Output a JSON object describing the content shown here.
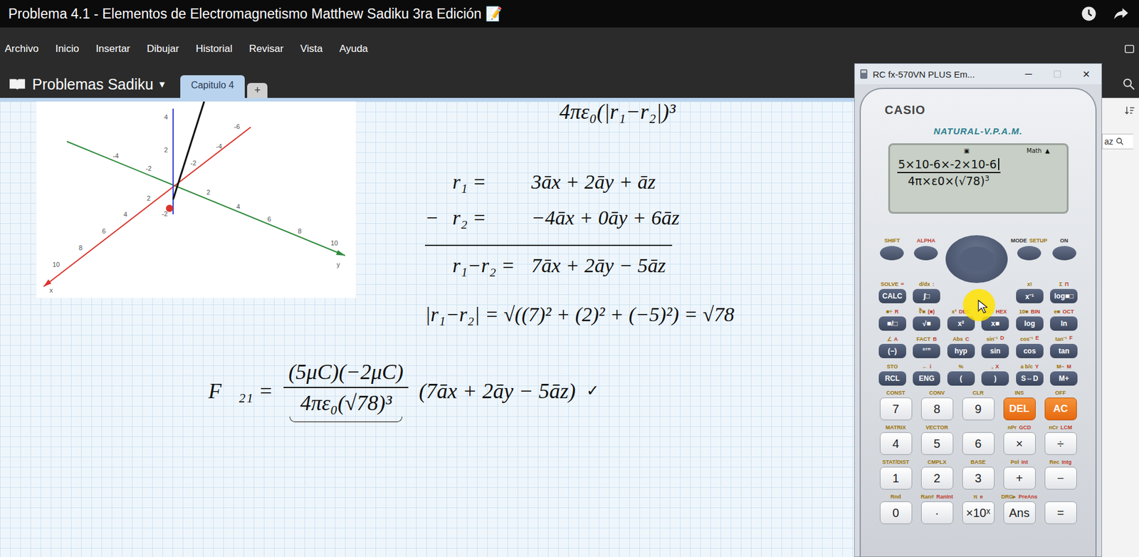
{
  "video": {
    "title": "Problema 4.1 - Elementos de Electromagnetismo Matthew Sadiku 3ra Edición 📝"
  },
  "menu": [
    "Archivo",
    "Inicio",
    "Insertar",
    "Dibujar",
    "Historial",
    "Revisar",
    "Vista",
    "Ayuda"
  ],
  "notebook": {
    "name": "Problemas Sadiku",
    "caret": "▾"
  },
  "tabs": [
    {
      "label": "Capitulo 4",
      "selected": true
    },
    {
      "label": "+",
      "selected": false
    }
  ],
  "graph": {
    "y_labels": [
      "-4",
      "-2",
      "2",
      "4",
      "6",
      "8",
      "10",
      "y"
    ],
    "x_labels": [
      "-6",
      "-4",
      "-2",
      "2",
      "4",
      "6",
      "8",
      "10",
      "x"
    ],
    "z_labels": [
      "4",
      "2",
      "-2"
    ]
  },
  "work": {
    "header": "4πε₀(|r₁−r₂|)³",
    "lines": [
      {
        "sign": "",
        "lhs": "r₁ =",
        "rhs": "3āx + 2āy + āz"
      },
      {
        "sign": "−",
        "lhs": "r₂ =",
        "rhs": "−4āx + 0āy + 6āz"
      },
      {
        "sign": "",
        "lhs": "r₁−r₂ =",
        "rhs": "7āx + 2āy − 5āz"
      }
    ],
    "magnitude": "|r₁−r₂| = √((7)² + (2)² + (−5)²) = √78",
    "force": {
      "lhs": "F⃗₂₁ =",
      "numerator": "(5μC)(−2μC)",
      "denominator": "4πε₀(√78)³",
      "vector": "(7āx + 2āy − 5āz)",
      "mark": "✓"
    }
  },
  "right_panel": {
    "search_text": "az"
  },
  "calculator": {
    "title": "RC fx-570VN PLUS Em...",
    "controls": [
      {
        "symbol": "─",
        "disabled": false
      },
      {
        "symbol": "☐",
        "disabled": true
      },
      {
        "symbol": "✕",
        "disabled": false
      }
    ],
    "brand": "CASIO",
    "model": "NATURAL-V.P.A.M.",
    "display": {
      "indicator": "▣",
      "mode": "Math",
      "arrow": "▲",
      "numerator": "5×10-6×-2×10-6",
      "denominator": "4π×ε0×(√78)",
      "exponent": "3"
    },
    "top_keys": [
      {
        "above": "SHIFT",
        "kind": "shift"
      },
      {
        "above": "ALPHA",
        "kind": "alpha"
      },
      {
        "kind": "dpad"
      },
      {
        "above": "MODE",
        "shift": "SETUP",
        "kind": "mode"
      },
      {
        "above": "ON",
        "kind": "on"
      }
    ],
    "function_rows": [
      {
        "keys": [
          {
            "label": "CALC",
            "shift": "SOLVE",
            "alpha": "=",
            "kind": "func"
          },
          {
            "label": "∫□",
            "shift": "d/dx",
            "alpha": ":",
            "kind": "func"
          },
          {
            "label": "x⁻¹",
            "shift": "x!",
            "kind": "func"
          },
          {
            "label": "log■□",
            "shift": "Σ",
            "alpha": "Π",
            "kind": "func"
          }
        ]
      },
      {
        "keys": [
          {
            "label": "■/□",
            "shift": "■÷",
            "alpha": "R",
            "kind": "func"
          },
          {
            "label": "√■",
            "shift": "∛■",
            "alpha": "(■)",
            "kind": "func"
          },
          {
            "label": "x²",
            "shift": "x³",
            "alpha": "DEC",
            "kind": "func"
          },
          {
            "label": "x■",
            "shift": "■√□",
            "alpha": "HEX",
            "kind": "func"
          },
          {
            "label": "log",
            "shift": "10■",
            "alpha": "BIN",
            "kind": "func"
          },
          {
            "label": "ln",
            "shift": "e■",
            "alpha": "OCT",
            "kind": "func"
          }
        ]
      },
      {
        "keys": [
          {
            "label": "(−)",
            "shift": "∠",
            "alpha": "A",
            "kind": "func"
          },
          {
            "label": "°’”",
            "shift": "FACT",
            "alpha": "B",
            "kind": "func"
          },
          {
            "label": "hyp",
            "shift": "Abs",
            "alpha": "C",
            "kind": "func"
          },
          {
            "label": "sin",
            "shift": "sin⁻¹",
            "alpha": "D",
            "kind": "func"
          },
          {
            "label": "cos",
            "shift": "cos⁻¹",
            "alpha": "E",
            "kind": "func"
          },
          {
            "label": "tan",
            "shift": "tan⁻¹",
            "alpha": "F",
            "kind": "func"
          }
        ]
      },
      {
        "keys": [
          {
            "label": "RCL",
            "shift": "STO",
            "kind": "func"
          },
          {
            "label": "ENG",
            "shift": "←",
            "alpha": "i",
            "kind": "func"
          },
          {
            "label": "(",
            "shift": "%",
            "kind": "func"
          },
          {
            "label": ")",
            "shift": ",",
            "alpha": "X",
            "kind": "func"
          },
          {
            "label": "S⇔D",
            "shift": "a b/c",
            "alpha": "Y",
            "kind": "func"
          },
          {
            "label": "M+",
            "shift": "M−",
            "alpha": "M",
            "kind": "func"
          }
        ]
      }
    ],
    "number_rows": [
      {
        "keys": [
          {
            "label": "7",
            "shift": "CONST",
            "kind": "num"
          },
          {
            "label": "8",
            "shift": "CONV",
            "kind": "num"
          },
          {
            "label": "9",
            "shift": "CLR",
            "kind": "num"
          },
          {
            "label": "DEL",
            "shift": "INS",
            "kind": "orange"
          },
          {
            "label": "AC",
            "shift": "OFF",
            "kind": "orange"
          }
        ]
      },
      {
        "keys": [
          {
            "label": "4",
            "shift": "MATRIX",
            "kind": "num"
          },
          {
            "label": "5",
            "shift": "VECTOR",
            "kind": "num"
          },
          {
            "label": "6",
            "kind": "num"
          },
          {
            "label": "×",
            "shift": "nPr",
            "alpha": "GCD",
            "kind": "num"
          },
          {
            "label": "÷",
            "shift": "nCr",
            "alpha": "LCM",
            "kind": "num"
          }
        ]
      },
      {
        "keys": [
          {
            "label": "1",
            "shift": "STAT/DIST",
            "kind": "num"
          },
          {
            "label": "2",
            "shift": "CMPLX",
            "kind": "num"
          },
          {
            "label": "3",
            "shift": "BASE",
            "kind": "num"
          },
          {
            "label": "+",
            "shift": "Pol",
            "alpha": "Int",
            "kind": "num"
          },
          {
            "label": "−",
            "shift": "Rec",
            "alpha": "Intg",
            "kind": "num"
          }
        ]
      },
      {
        "keys": [
          {
            "label": "0",
            "shift": "Rnd",
            "kind": "num"
          },
          {
            "label": "·",
            "shift": "Ran#",
            "alpha": "RanInt",
            "kind": "num"
          },
          {
            "label": "×10ˣ",
            "shift": "π",
            "alpha": "e",
            "kind": "num"
          },
          {
            "label": "Ans",
            "shift": "DRG▸",
            "alpha": "PreAns",
            "kind": "num"
          },
          {
            "label": "=",
            "kind": "num"
          }
        ]
      }
    ]
  }
}
